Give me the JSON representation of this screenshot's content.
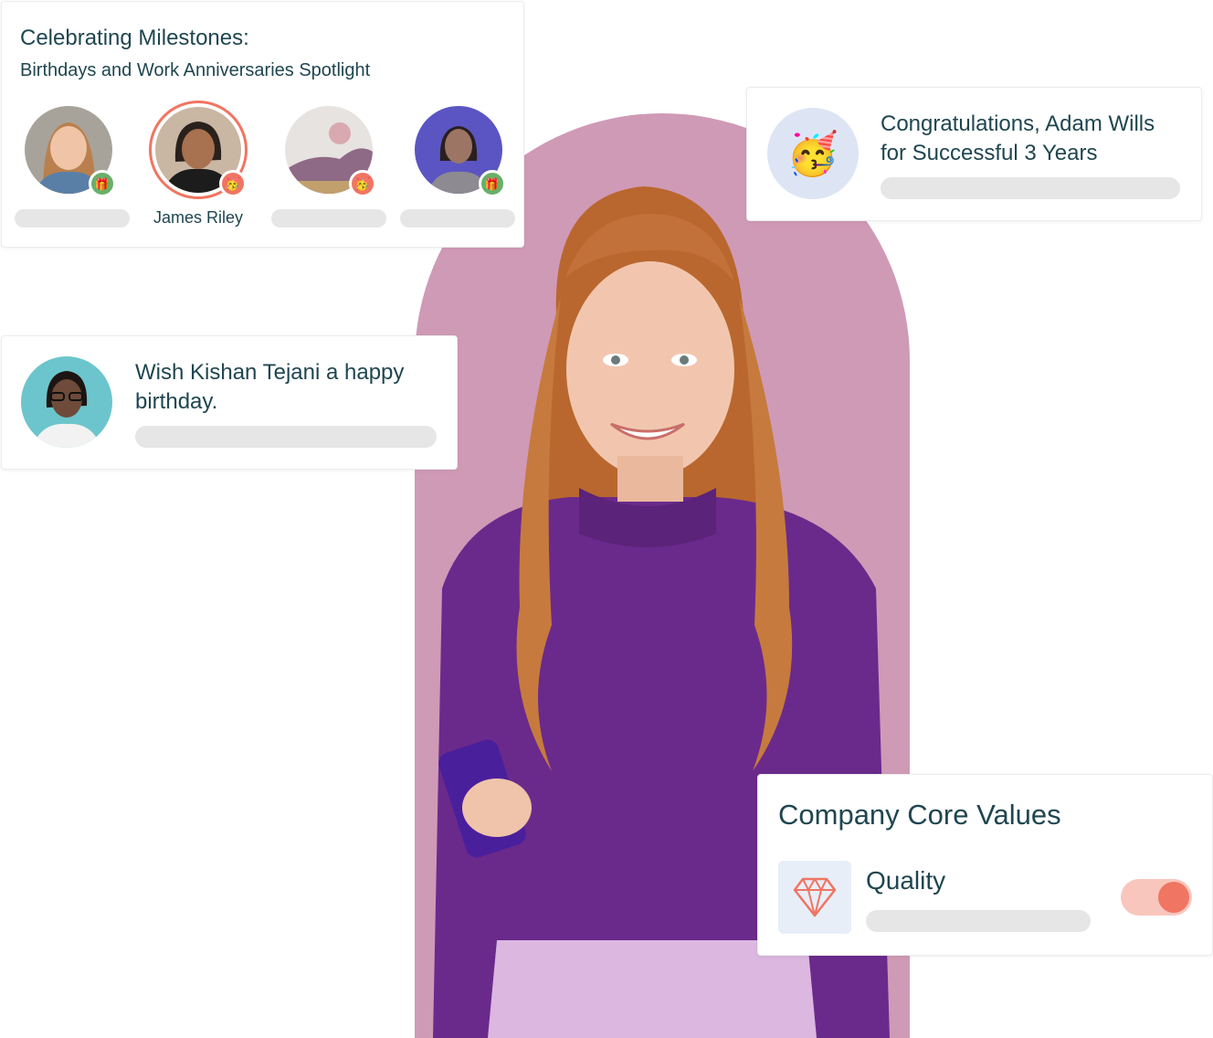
{
  "milestones": {
    "title": "Celebrating Milestones:",
    "subtitle": "Birthdays and Work Anniversaries Spotlight",
    "people": [
      {
        "name": "",
        "badge": "gift-icon"
      },
      {
        "name": "James Riley",
        "badge": "party-face-icon",
        "highlighted": true
      },
      {
        "name": "",
        "badge": "party-face-icon"
      },
      {
        "name": "",
        "badge": "gift-icon"
      }
    ]
  },
  "congrats": {
    "icon": "party-face-icon",
    "text": "Congratulations, Adam Wills for Successful 3 Years"
  },
  "birthday": {
    "text": "Wish Kishan Tejani a happy birthday."
  },
  "core_values": {
    "title": "Company Core Values",
    "value_label": "Quality",
    "value_icon": "diamond-icon",
    "toggle_on": true
  },
  "colors": {
    "text": "#1f4650",
    "accent": "#f07562",
    "gift_badge": "#68b06a",
    "arch": "#cf9ab6",
    "sweater": "#6a2a8c"
  }
}
